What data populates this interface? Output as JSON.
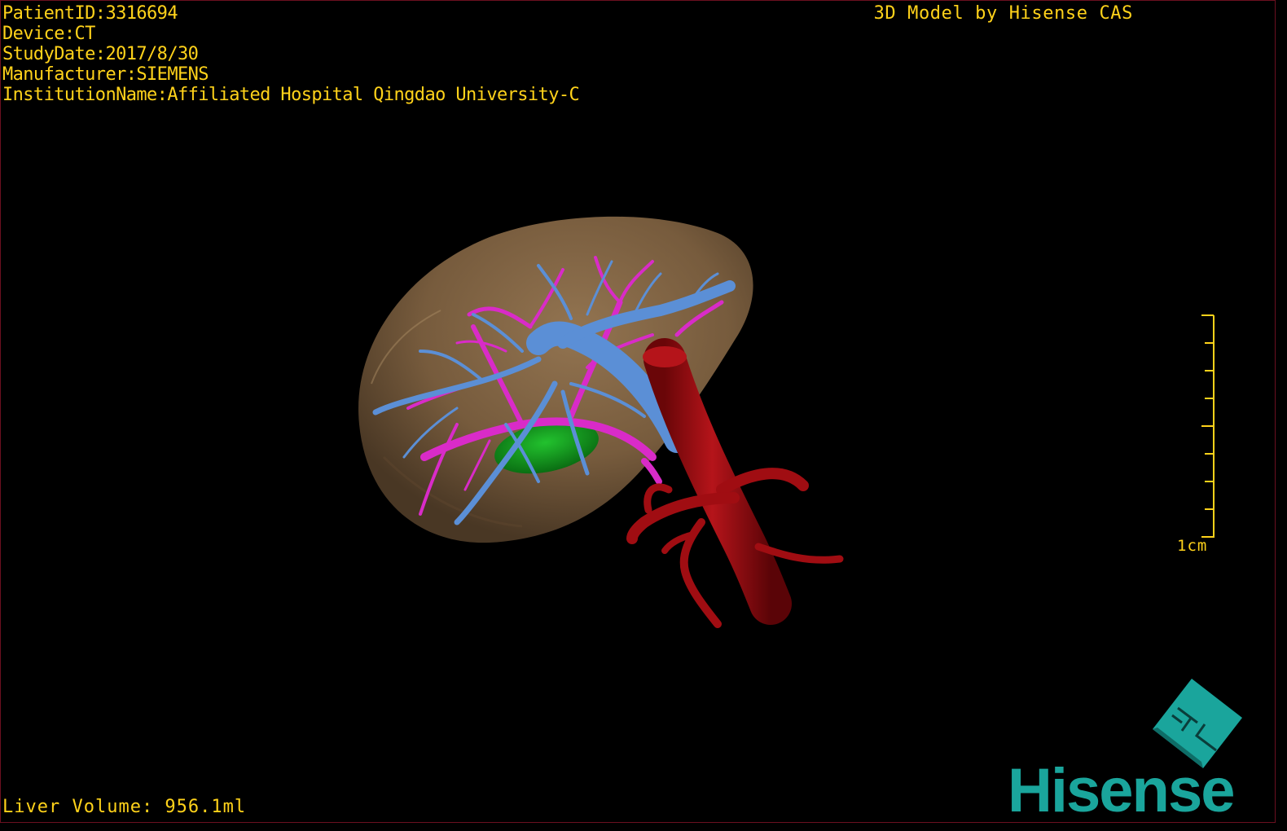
{
  "overlay": {
    "patient_id": "PatientID:3316694",
    "device": "Device:CT",
    "study_date": "StudyDate:2017/8/30",
    "manufacturer": "Manufacturer:SIEMENS",
    "institution": "InstitutionName:Affiliated Hospital Qingdao University-C",
    "watermark": "3D Model by Hisense CAS",
    "liver_volume": "Liver Volume: 956.1ml"
  },
  "scale": {
    "label": "1cm",
    "color": "#ffd21a"
  },
  "brand": {
    "name": "Hisense",
    "logo_letters": "HI",
    "color": "#1aa59c"
  },
  "model_colors": {
    "liver": "#8a6a4a",
    "portal_vein": "#5b8fd6",
    "hepatic_artery": "#e02ccf",
    "aorta": "#a00d12",
    "gallbladder": "#13a51f"
  },
  "icons": {
    "brand_logo": "hisense-diamond-icon"
  }
}
